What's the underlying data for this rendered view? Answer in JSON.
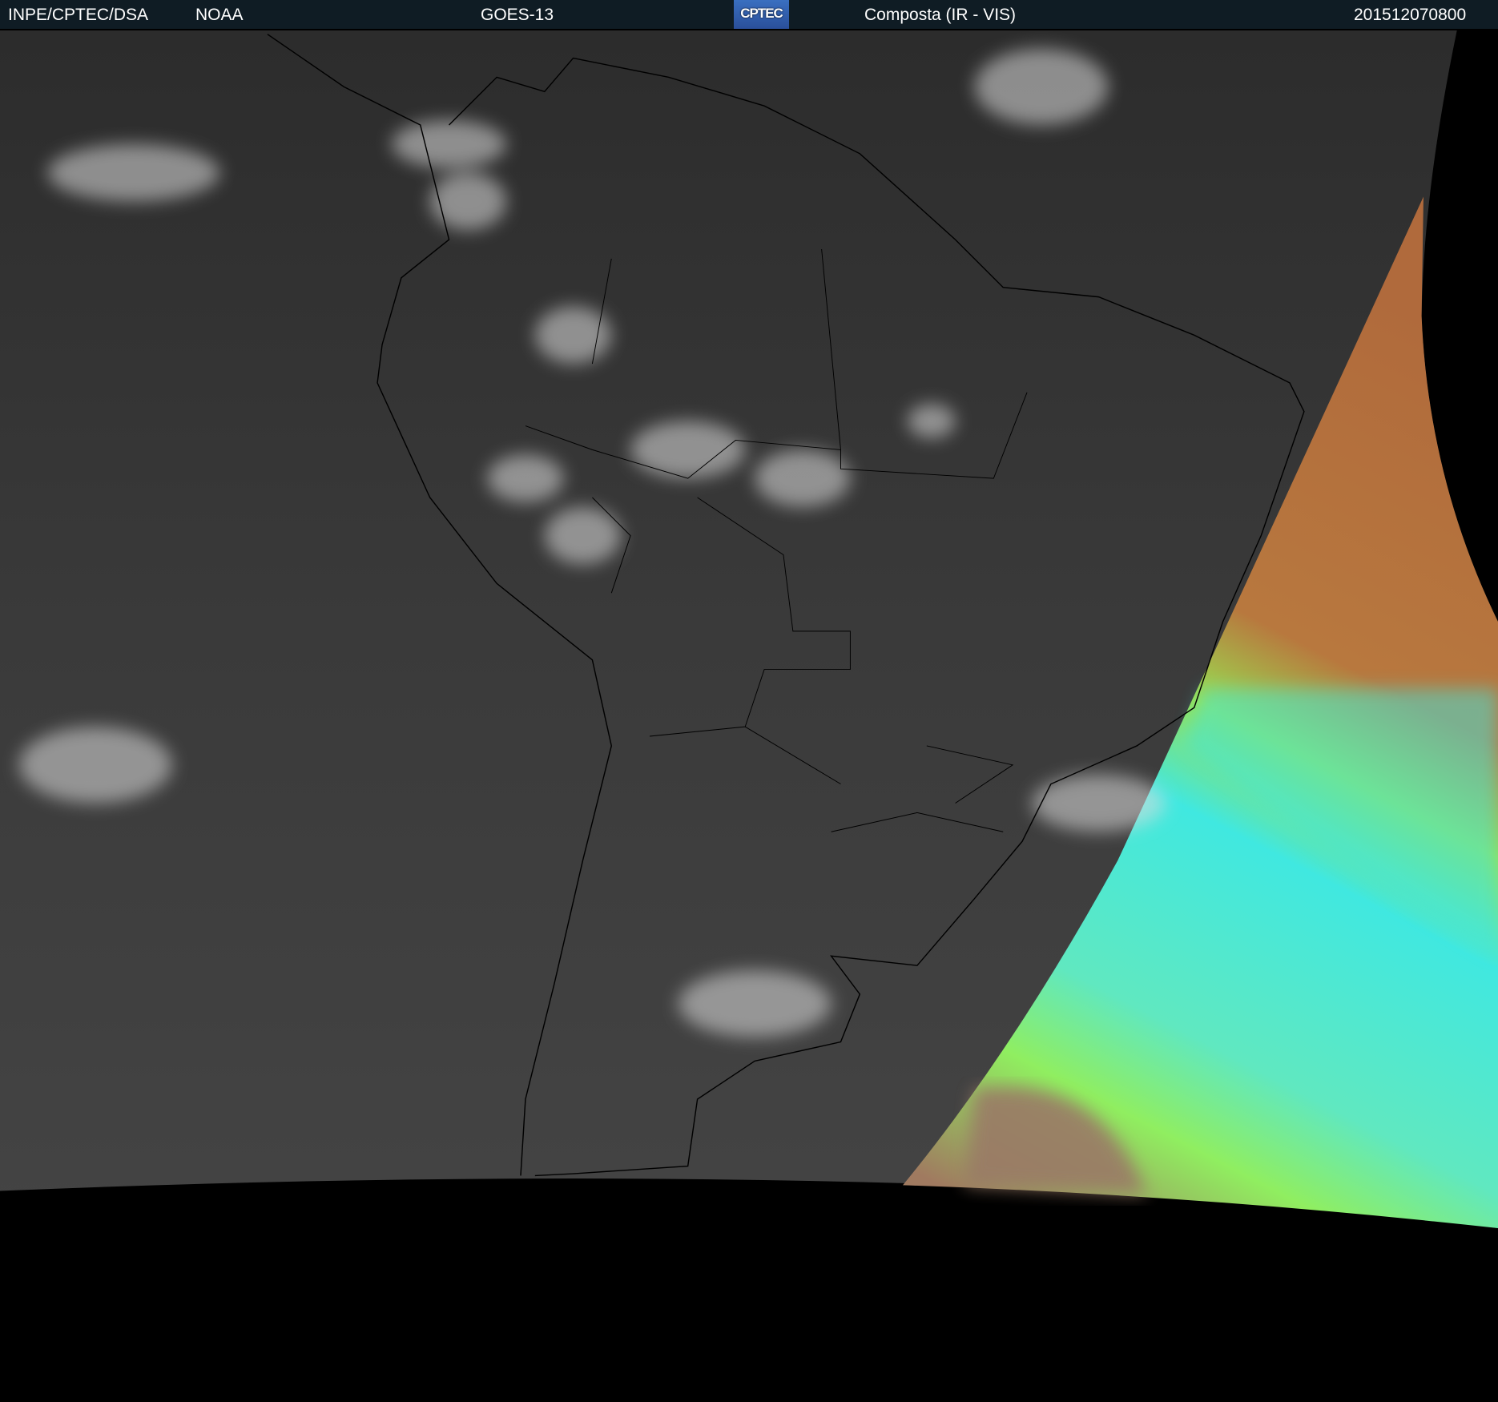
{
  "header": {
    "institution": "INPE/CPTEC/DSA",
    "agency": "NOAA",
    "satellite": "GOES-13",
    "logo_text": "CPTEC",
    "product": "Composta (IR - VIS)",
    "timestamp": "201512070800"
  },
  "colors": {
    "header_bg": "#0f1c24",
    "ir_gray": "#3a3a3a",
    "vis_orange": "#b8703a",
    "vis_green": "#80f060",
    "vis_cyan": "#30e8e0",
    "space": "#000000"
  }
}
